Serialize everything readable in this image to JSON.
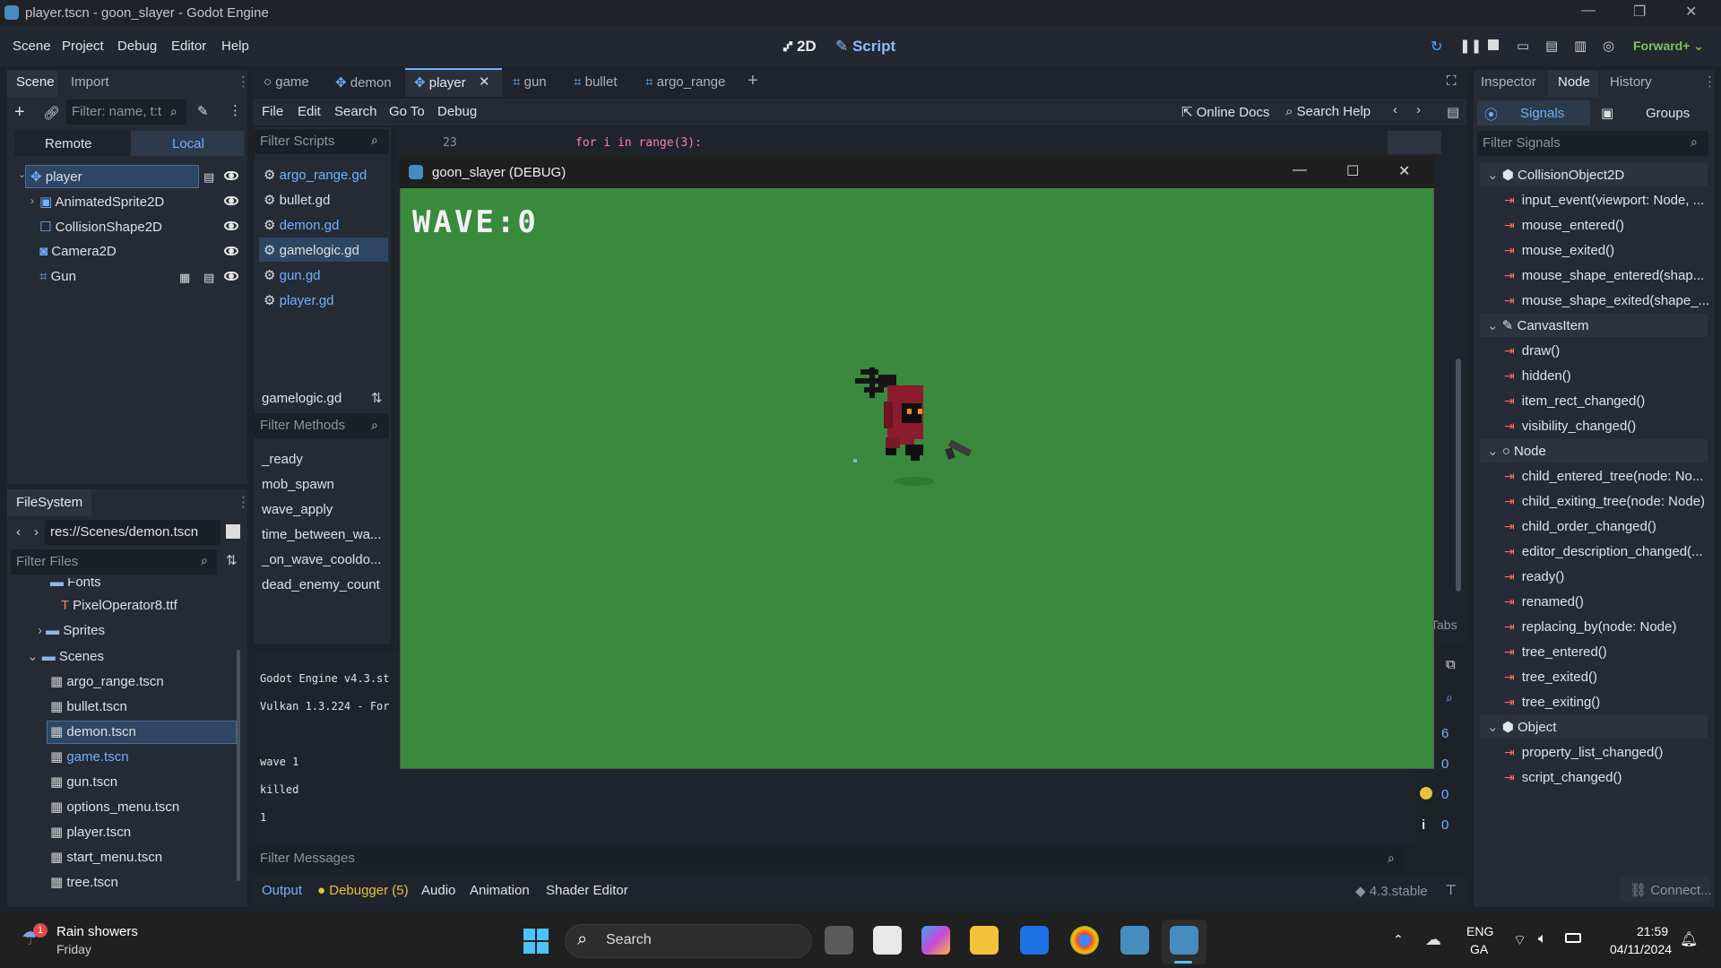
{
  "window": {
    "title": "player.tscn - goon_slayer - Godot Engine"
  },
  "menu": {
    "scene": "Scene",
    "project": "Project",
    "debug": "Debug",
    "editor": "Editor",
    "help": "Help",
    "mode_2d": "2D",
    "mode_script": "Script",
    "renderer": "Forward+"
  },
  "scene_dock": {
    "tabs": [
      "Scene",
      "Import"
    ],
    "filter_placeholder": "Filter: name, t:t",
    "remote": "Remote",
    "local": "Local",
    "nodes": [
      "player",
      "AnimatedSprite2D",
      "CollisionShape2D",
      "Camera2D",
      "Gun"
    ]
  },
  "filesystem": {
    "tab": "FileSystem",
    "path": "res://Scenes/demon.tscn",
    "filter_placeholder": "Filter Files",
    "items": [
      "Fonts",
      "PixelOperator8.ttf",
      "Sprites",
      "Scenes",
      "argo_range.tscn",
      "bullet.tscn",
      "demon.tscn",
      "game.tscn",
      "gun.tscn",
      "options_menu.tscn",
      "player.tscn",
      "start_menu.tscn",
      "tree.tscn"
    ]
  },
  "editor_tabs": [
    "game",
    "demon",
    "player",
    "gun",
    "bullet",
    "argo_range"
  ],
  "script_menu": {
    "file": "File",
    "edit": "Edit",
    "search": "Search",
    "goto": "Go To",
    "debug": "Debug",
    "online_docs": "Online Docs",
    "search_help": "Search Help"
  },
  "scripts": {
    "filter_placeholder": "Filter Scripts",
    "list": [
      "argo_range.gd",
      "bullet.gd",
      "demon.gd",
      "gamelogic.gd",
      "gun.gd",
      "player.gd"
    ],
    "current": "gamelogic.gd",
    "methods_placeholder": "Filter Methods",
    "methods": [
      "_ready",
      "mob_spawn",
      "wave_apply",
      "time_between_wa...",
      "_on_wave_cooldo...",
      "dead_enemy_count"
    ]
  },
  "code": {
    "line_no": "23",
    "line_text": "for i in range(3):"
  },
  "output": {
    "lines": [
      "Godot Engine v4.3.st",
      "Vulkan 1.3.224 - For",
      "",
      "wave 1",
      "killed",
      "1"
    ],
    "filter_placeholder": "Filter Messages",
    "tabs_label": "Tabs",
    "counts": [
      "6",
      "0",
      "0",
      "0"
    ]
  },
  "bottom_tabs": {
    "output": "Output",
    "debugger": "Debugger (5)",
    "audio": "Audio",
    "animation": "Animation",
    "shader": "Shader Editor",
    "version": "4.3.stable"
  },
  "game": {
    "title": "goon_slayer (DEBUG)",
    "hud": "WAVE:0"
  },
  "inspector": {
    "tabs": [
      "Inspector",
      "Node",
      "History"
    ],
    "signals_tab": "Signals",
    "groups_tab": "Groups",
    "filter_placeholder": "Filter Signals",
    "sections": [
      {
        "name": "CollisionObject2D",
        "signals": [
          "input_event(viewport: Node, ...",
          "mouse_entered()",
          "mouse_exited()",
          "mouse_shape_entered(shap...",
          "mouse_shape_exited(shape_..."
        ]
      },
      {
        "name": "CanvasItem",
        "signals": [
          "draw()",
          "hidden()",
          "item_rect_changed()",
          "visibility_changed()"
        ]
      },
      {
        "name": "Node",
        "signals": [
          "child_entered_tree(node: No...",
          "child_exiting_tree(node: Node)",
          "child_order_changed()",
          "editor_description_changed(...",
          "ready()",
          "renamed()",
          "replacing_by(node: Node)",
          "tree_entered()",
          "tree_exited()",
          "tree_exiting()"
        ]
      },
      {
        "name": "Object",
        "signals": [
          "property_list_changed()",
          "script_changed()"
        ]
      }
    ],
    "connect": "Connect..."
  },
  "taskbar": {
    "weather": "Rain showers",
    "day": "Friday",
    "badge": "1",
    "search": "Search",
    "lang1": "ENG",
    "lang2": "GA",
    "time": "21:59",
    "date": "04/11/2024"
  }
}
